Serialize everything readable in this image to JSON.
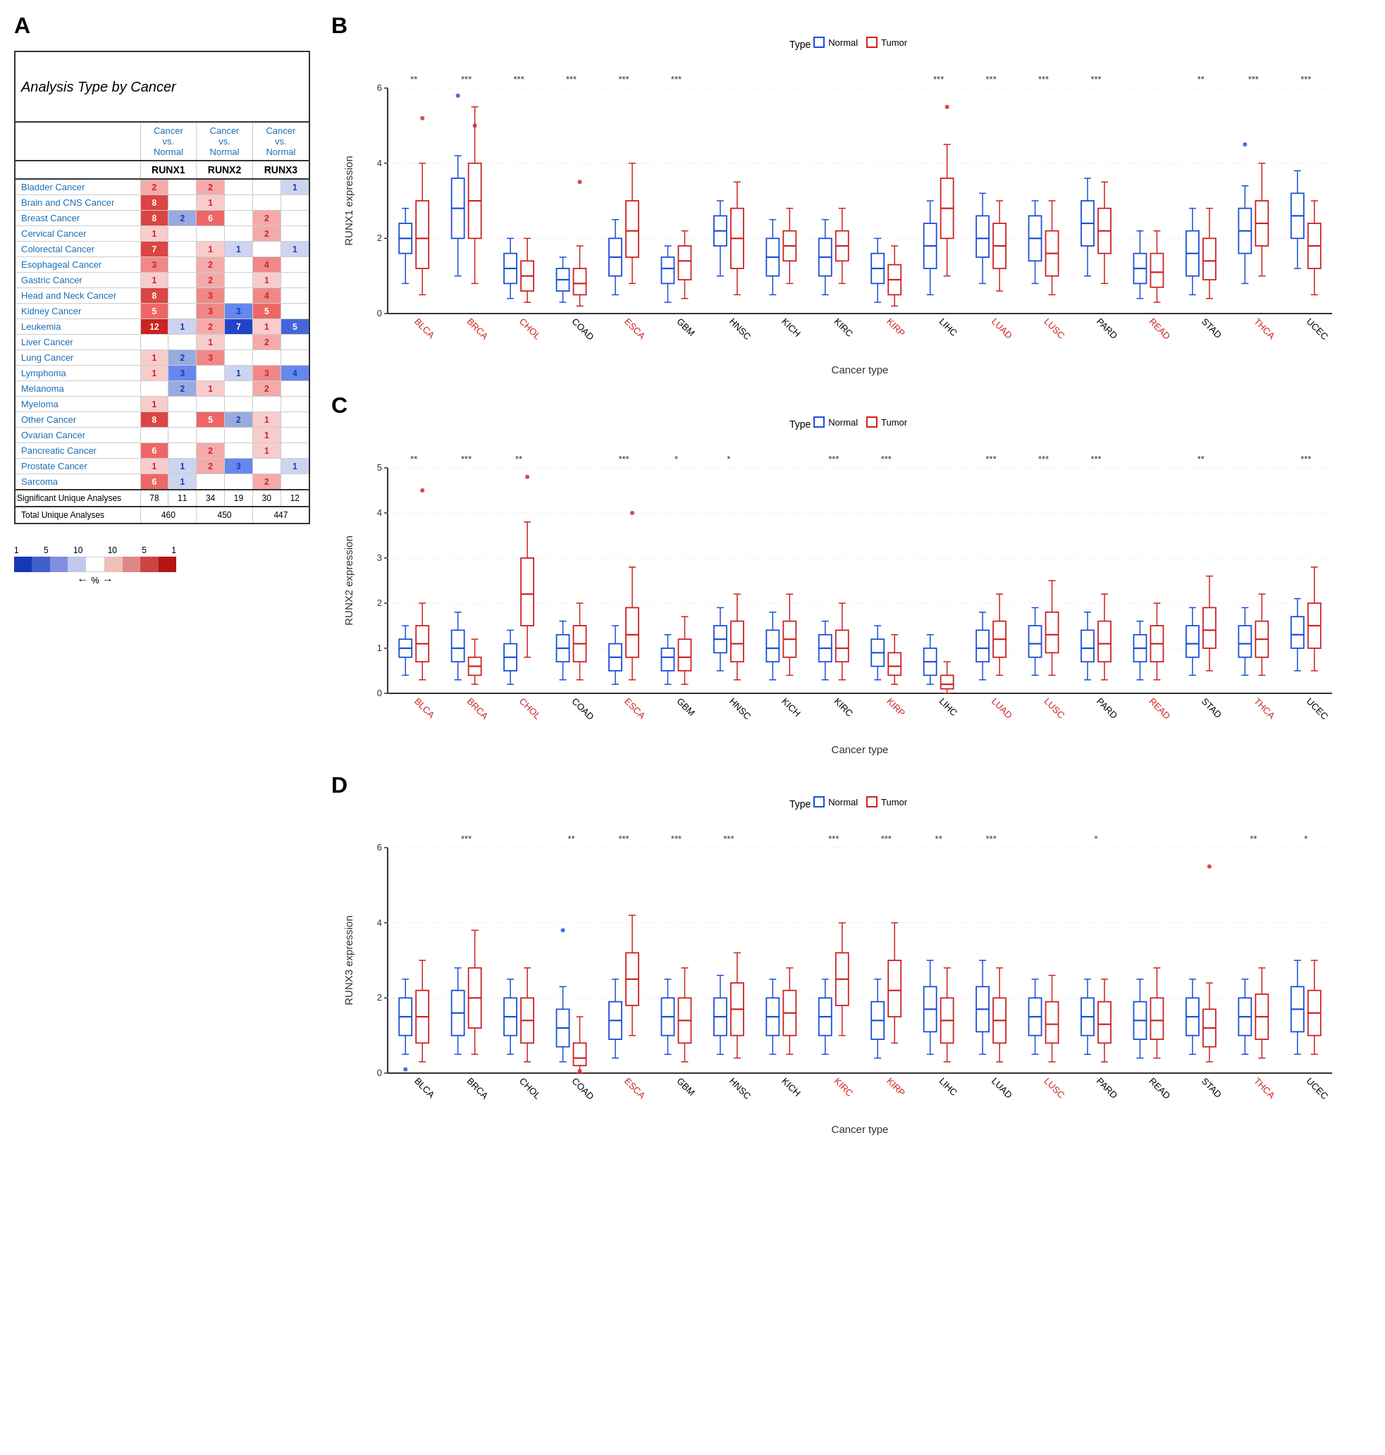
{
  "sections": {
    "A": "A",
    "B": "B",
    "C": "C",
    "D": "D"
  },
  "table": {
    "title": "Analysis Type by Cancer",
    "headers": [
      {
        "main": "Cancer vs. Normal",
        "gene": "RUNX1"
      },
      {
        "main": "Cancer vs. Normal",
        "gene": "RUNX2"
      },
      {
        "main": "Cancer vs. Normal",
        "gene": "RUNX3"
      }
    ],
    "rows": [
      {
        "cancer": "Bladder Cancer",
        "r1_up": 2,
        "r1_dn": null,
        "r2_up": 2,
        "r2_dn": null,
        "r3_up": null,
        "r3_dn": 1
      },
      {
        "cancer": "Brain and CNS Cancer",
        "r1_up": 8,
        "r1_dn": null,
        "r2_up": 1,
        "r2_dn": null,
        "r3_up": null,
        "r3_dn": null
      },
      {
        "cancer": "Breast Cancer",
        "r1_up": 8,
        "r1_dn": 2,
        "r2_up": 6,
        "r2_dn": null,
        "r3_up": 2,
        "r3_dn": null
      },
      {
        "cancer": "Cervical Cancer",
        "r1_up": 1,
        "r1_dn": null,
        "r2_up": null,
        "r2_dn": null,
        "r3_up": 2,
        "r3_dn": null
      },
      {
        "cancer": "Colorectal Cancer",
        "r1_up": 7,
        "r1_dn": null,
        "r2_up": 1,
        "r2_dn": 1,
        "r3_up": null,
        "r3_dn": 1
      },
      {
        "cancer": "Esophageal Cancer",
        "r1_up": 3,
        "r1_dn": null,
        "r2_up": 2,
        "r2_dn": null,
        "r3_up": 4,
        "r3_dn": null
      },
      {
        "cancer": "Gastric Cancer",
        "r1_up": 1,
        "r1_dn": null,
        "r2_up": 2,
        "r2_dn": null,
        "r3_up": 1,
        "r3_dn": null
      },
      {
        "cancer": "Head and Neck Cancer",
        "r1_up": 8,
        "r1_dn": null,
        "r2_up": 3,
        "r2_dn": null,
        "r3_up": 4,
        "r3_dn": null
      },
      {
        "cancer": "Kidney Cancer",
        "r1_up": 5,
        "r1_dn": null,
        "r2_up": 3,
        "r2_dn": 3,
        "r3_up": 5,
        "r3_dn": null
      },
      {
        "cancer": "Leukemia",
        "r1_up": 12,
        "r1_dn": 1,
        "r2_up": 2,
        "r2_dn": 7,
        "r3_up": 1,
        "r3_dn": 5
      },
      {
        "cancer": "Liver Cancer",
        "r1_up": null,
        "r1_dn": null,
        "r2_up": 1,
        "r2_dn": null,
        "r3_up": 2,
        "r3_dn": null
      },
      {
        "cancer": "Lung Cancer",
        "r1_up": 1,
        "r1_dn": 2,
        "r2_up": 3,
        "r2_dn": null,
        "r3_up": null,
        "r3_dn": null
      },
      {
        "cancer": "Lymphoma",
        "r1_up": 1,
        "r1_dn": 3,
        "r2_up": null,
        "r2_dn": 1,
        "r3_up": 3,
        "r3_dn": 4
      },
      {
        "cancer": "Melanoma",
        "r1_up": null,
        "r1_dn": 2,
        "r2_up": 1,
        "r2_dn": null,
        "r3_up": 2,
        "r3_dn": null
      },
      {
        "cancer": "Myeloma",
        "r1_up": 1,
        "r1_dn": null,
        "r2_up": null,
        "r2_dn": null,
        "r3_up": null,
        "r3_dn": null
      },
      {
        "cancer": "Other Cancer",
        "r1_up": 8,
        "r1_dn": null,
        "r2_up": 5,
        "r2_dn": 2,
        "r3_up": 1,
        "r3_dn": null
      },
      {
        "cancer": "Ovarian Cancer",
        "r1_up": null,
        "r1_dn": null,
        "r2_up": null,
        "r2_dn": null,
        "r3_up": 1,
        "r3_dn": null
      },
      {
        "cancer": "Pancreatic Cancer",
        "r1_up": 6,
        "r1_dn": null,
        "r2_up": 2,
        "r2_dn": null,
        "r3_up": 1,
        "r3_dn": null
      },
      {
        "cancer": "Prostate Cancer",
        "r1_up": 1,
        "r1_dn": 1,
        "r2_up": 2,
        "r2_dn": 3,
        "r3_up": null,
        "r3_dn": 1
      },
      {
        "cancer": "Sarcoma",
        "r1_up": 6,
        "r1_dn": 1,
        "r2_up": null,
        "r2_dn": null,
        "r3_up": 2,
        "r3_dn": null
      }
    ],
    "footer": {
      "sig_label": "Significant Unique Analyses",
      "total_label": "Total Unique Analyses",
      "r1_sig_up": 78,
      "r1_sig_dn": 11,
      "r2_sig_up": 34,
      "r2_sig_dn": 19,
      "r3_sig_up": 30,
      "r3_sig_dn": 12,
      "r1_total": 460,
      "r2_total": 450,
      "r3_total": 447
    }
  },
  "charts": {
    "B": {
      "label": "B",
      "legend_normal": "Normal",
      "legend_tumor": "Tumor",
      "y_label": "RUNX1 expression",
      "x_label": "Cancer type",
      "sig_stars": [
        "**",
        "***",
        "***",
        "***",
        "***",
        "***",
        "",
        "",
        "",
        "",
        "***",
        "***",
        "***",
        "***",
        "",
        "**",
        "***",
        "***",
        "***",
        "***"
      ],
      "x_labels": [
        "BLCA",
        "BRCA",
        "CHOL",
        "COAD",
        "ESCA",
        "GBM",
        "HNSC",
        "KICH",
        "KIRC",
        "KIRP",
        "LIHC",
        "LUAD",
        "LUSC",
        "PARD",
        "READ",
        "STAD",
        "THCA",
        "UCEC"
      ],
      "y_ticks": [
        0,
        2,
        4,
        6
      ]
    },
    "C": {
      "label": "C",
      "legend_normal": "Normal",
      "legend_tumor": "Tumor",
      "y_label": "RUNX2 expression",
      "x_label": "Cancer type",
      "sig_stars": [
        "**",
        "***",
        "**",
        "",
        "***",
        "*",
        "*",
        "",
        "***",
        "***",
        "",
        "***",
        "***",
        "***",
        "",
        "**",
        "",
        "***"
      ],
      "x_labels": [
        "BLCA",
        "BRCA",
        "CHOL",
        "COAD",
        "ESCA",
        "GBM",
        "HNSC",
        "KICH",
        "KIRC",
        "KIRP",
        "LIHC",
        "LUAD",
        "LUSC",
        "PARD",
        "READ",
        "STAD",
        "THCA",
        "UCEC"
      ],
      "y_ticks": [
        0,
        1,
        2,
        3,
        4,
        5
      ]
    },
    "D": {
      "label": "D",
      "legend_normal": "Normal",
      "legend_tumor": "Tumor",
      "y_label": "RUNX3 expression",
      "x_label": "Cancer type",
      "sig_stars": [
        "",
        "***",
        "",
        "**",
        "***",
        "***",
        "***",
        "",
        "***",
        "***",
        "**",
        "***",
        "",
        "*",
        "",
        "",
        "**",
        "*",
        "***"
      ],
      "x_labels": [
        "BLCA",
        "BRCA",
        "CHOL",
        "COAD",
        "ESCA",
        "GBM",
        "HNSC",
        "KICH",
        "KIRC",
        "KIRP",
        "LIHC",
        "LUAD",
        "LUSC",
        "PARD",
        "READ",
        "STAD",
        "THCA",
        "UCEC"
      ],
      "y_ticks": [
        0,
        2,
        4,
        6
      ]
    }
  },
  "legend": {
    "values_blue": [
      1,
      5,
      10
    ],
    "values_red": [
      10,
      5,
      1
    ],
    "percent_label": "%"
  }
}
